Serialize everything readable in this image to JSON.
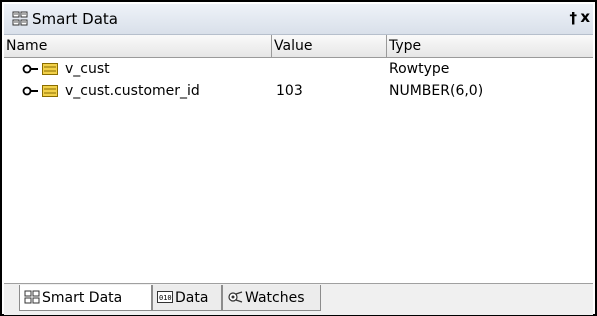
{
  "panel": {
    "title": "Smart Data",
    "pin_glyph": "†",
    "close_glyph": "x"
  },
  "columns": {
    "name": "Name",
    "value": "Value",
    "type": "Type"
  },
  "rows": [
    {
      "name": "v_cust",
      "value": "",
      "type": "Rowtype"
    },
    {
      "name": "v_cust.customer_id",
      "value": "103",
      "type": "NUMBER(6,0)"
    }
  ],
  "tabs": [
    {
      "label": "Smart Data",
      "icon": "smart-data-icon",
      "active": true
    },
    {
      "label": "Data",
      "icon": "data-icon",
      "active": false
    },
    {
      "label": "Watches",
      "icon": "watches-icon",
      "active": false
    }
  ],
  "colors": {
    "field_icon": "#f2d14a",
    "field_icon_border": "#8a6d00",
    "title_gradient_top": "#eef2f8",
    "title_gradient_bottom": "#d9e0ea"
  }
}
